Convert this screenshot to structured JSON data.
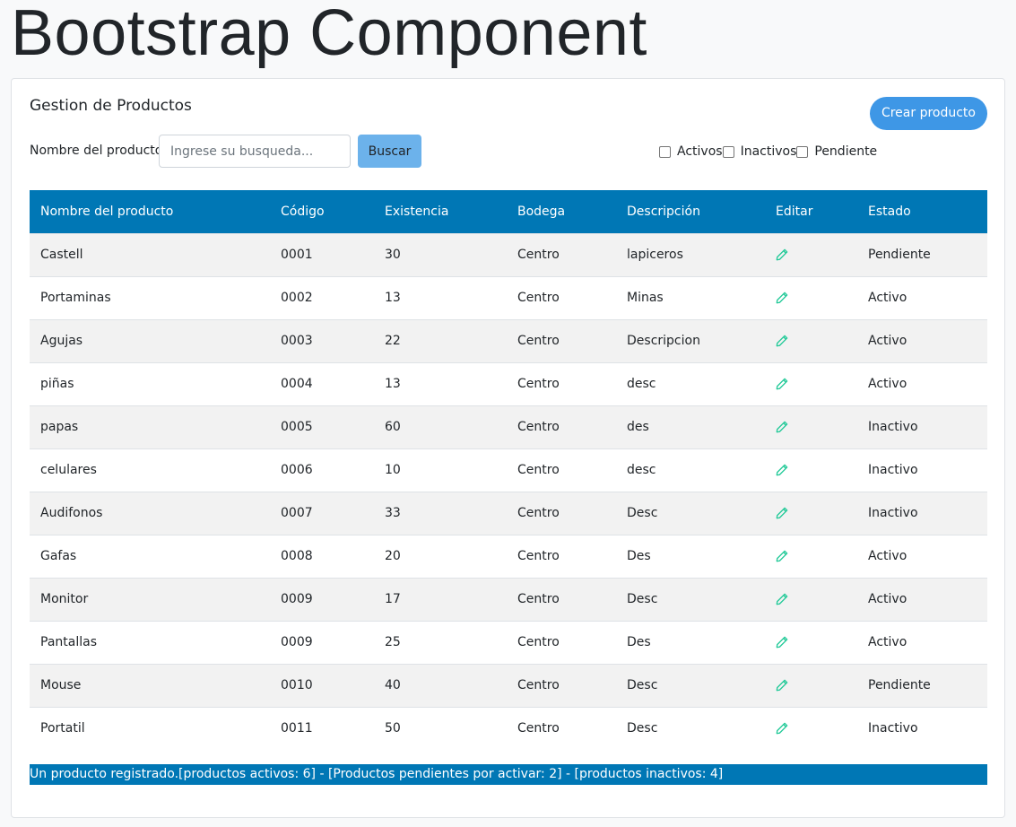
{
  "page": {
    "title": "Bootstrap Component"
  },
  "card": {
    "title": "Gestion de Productos",
    "create_label": "Crear producto",
    "search": {
      "label": "Nombre del producto",
      "placeholder": "Ingrese su busqueda...",
      "button_label": "Buscar"
    },
    "filters": [
      {
        "label": "Activos",
        "checked": false
      },
      {
        "label": "Inactivos",
        "checked": false
      },
      {
        "label": "Pendiente",
        "checked": false
      }
    ]
  },
  "table": {
    "columns": [
      "Nombre del producto",
      "Código",
      "Existencia",
      "Bodega",
      "Descripción",
      "Editar",
      "Estado"
    ],
    "rows": [
      {
        "nombre": "Castell",
        "codigo": "0001",
        "existencia": "30",
        "bodega": "Centro",
        "descripcion": "lapiceros",
        "estado": "Pendiente"
      },
      {
        "nombre": "Portaminas",
        "codigo": "0002",
        "existencia": "13",
        "bodega": "Centro",
        "descripcion": "Minas",
        "estado": "Activo"
      },
      {
        "nombre": "Agujas",
        "codigo": "0003",
        "existencia": "22",
        "bodega": "Centro",
        "descripcion": "Descripcion",
        "estado": "Activo"
      },
      {
        "nombre": "piñas",
        "codigo": "0004",
        "existencia": "13",
        "bodega": "Centro",
        "descripcion": "desc",
        "estado": "Activo"
      },
      {
        "nombre": "papas",
        "codigo": "0005",
        "existencia": "60",
        "bodega": "Centro",
        "descripcion": "des",
        "estado": "Inactivo"
      },
      {
        "nombre": "celulares",
        "codigo": "0006",
        "existencia": "10",
        "bodega": "Centro",
        "descripcion": "desc",
        "estado": "Inactivo"
      },
      {
        "nombre": "Audifonos",
        "codigo": "0007",
        "existencia": "33",
        "bodega": "Centro",
        "descripcion": "Desc",
        "estado": "Inactivo"
      },
      {
        "nombre": "Gafas",
        "codigo": "0008",
        "existencia": "20",
        "bodega": "Centro",
        "descripcion": "Des",
        "estado": "Activo"
      },
      {
        "nombre": "Monitor",
        "codigo": "0009",
        "existencia": "17",
        "bodega": "Centro",
        "descripcion": "Desc",
        "estado": "Activo"
      },
      {
        "nombre": "Pantallas",
        "codigo": "0009",
        "existencia": "25",
        "bodega": "Centro",
        "descripcion": "Des",
        "estado": "Activo"
      },
      {
        "nombre": "Mouse",
        "codigo": "0010",
        "existencia": "40",
        "bodega": "Centro",
        "descripcion": "Desc",
        "estado": "Pendiente"
      },
      {
        "nombre": "Portatil",
        "codigo": "0011",
        "existencia": "50",
        "bodega": "Centro",
        "descripcion": "Desc",
        "estado": "Inactivo"
      }
    ]
  },
  "summary": {
    "text": "Un producto registrado.[productos activos: 6] - [Productos pendientes por activar: 2] - [productos inactivos: 4]"
  },
  "colors": {
    "header_bg": "#0077b5",
    "primary_button": "#3e97e6",
    "search_button": "#6cb2eb",
    "edit_icon": "#20c997"
  },
  "icons": {
    "edit": "pencil-icon"
  }
}
